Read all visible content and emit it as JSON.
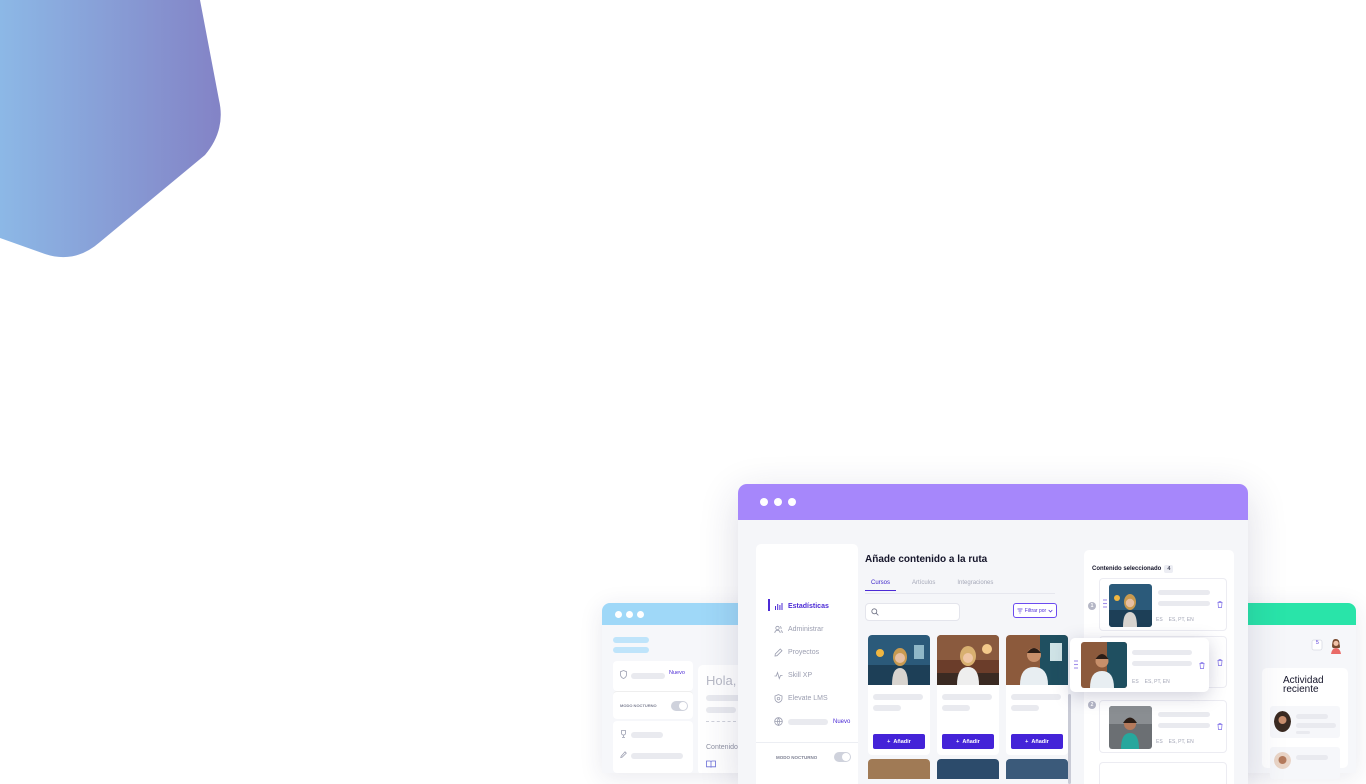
{
  "main_window": {
    "sidebar": {
      "items": [
        {
          "label": "Estadísticas",
          "icon": "bar-chart-icon",
          "active": true
        },
        {
          "label": "Administrar",
          "icon": "users-icon",
          "active": false
        },
        {
          "label": "Proyectos",
          "icon": "pencil-icon",
          "active": false
        },
        {
          "label": "Skill XP",
          "icon": "pulse-icon",
          "active": false
        },
        {
          "label": "Elevate LMS",
          "icon": "shield-icon",
          "active": false
        }
      ],
      "globe_badge": "Nuevo",
      "night_mode_label": "MODO NOCTURNO"
    },
    "content": {
      "title": "Añade contenido a la ruta",
      "tabs": [
        {
          "label": "Cursos",
          "active": true
        },
        {
          "label": "Artículos",
          "active": false
        },
        {
          "label": "Integraciones",
          "active": false
        }
      ],
      "filter_label": "Filtrar por",
      "add_label": "Añadir"
    },
    "selected_panel": {
      "title": "Contenido seleccionado",
      "count": "4",
      "items": [
        {
          "meta_level": "ES",
          "meta_langs": "ES, PT, EN",
          "number": "1"
        },
        {
          "meta_level": "ES",
          "meta_langs": "ES, PT, EN",
          "number": "2"
        },
        {
          "meta_level": "ES",
          "meta_langs": "ES, PT, EN",
          "number": "3"
        }
      ],
      "dragged": {
        "meta_level": "ES",
        "meta_langs": "ES, PT, EN"
      }
    }
  },
  "left_window": {
    "new_badge": "Nuevo",
    "night_mode_label": "MODO NOCTURNO",
    "greeting": "Hola, A",
    "section_label": "Contenido"
  },
  "right_window": {
    "activity_title": "Actividad reciente",
    "notification_count": "5"
  },
  "colors": {
    "accent": "#4423d8",
    "main_bar": "#a687fb",
    "left_bar": "#9fd8f8",
    "right_bar": "#29e4a9"
  }
}
